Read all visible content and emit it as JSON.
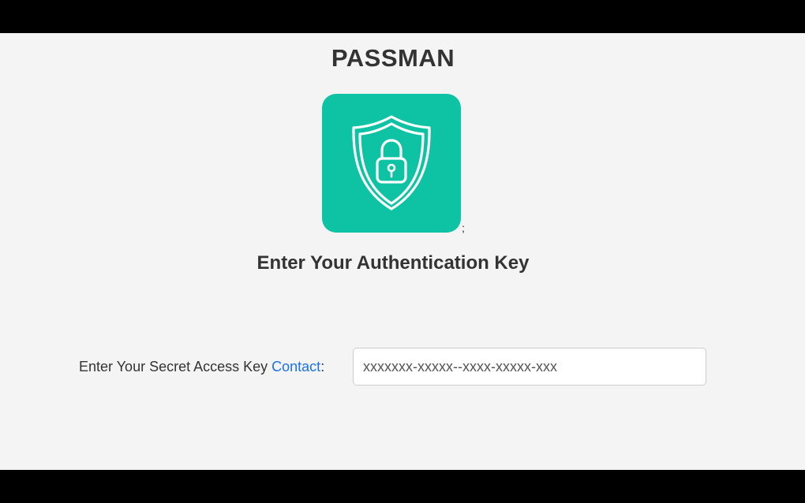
{
  "app": {
    "title": "PASSMAN",
    "logo_icon": "shield-lock-icon",
    "logo_color": "#0ec3a4",
    "stray_text": ";"
  },
  "auth": {
    "heading": "Enter Your Authentication Key",
    "label_prefix": "Enter Your Secret Access Key ",
    "contact_link": "Contact",
    "label_suffix": ":",
    "input_placeholder": "xxxxxxx-xxxxx--xxxx-xxxxx-xxx",
    "input_value": ""
  },
  "colors": {
    "link": "#1a73e8",
    "background": "#f4f4f4"
  }
}
